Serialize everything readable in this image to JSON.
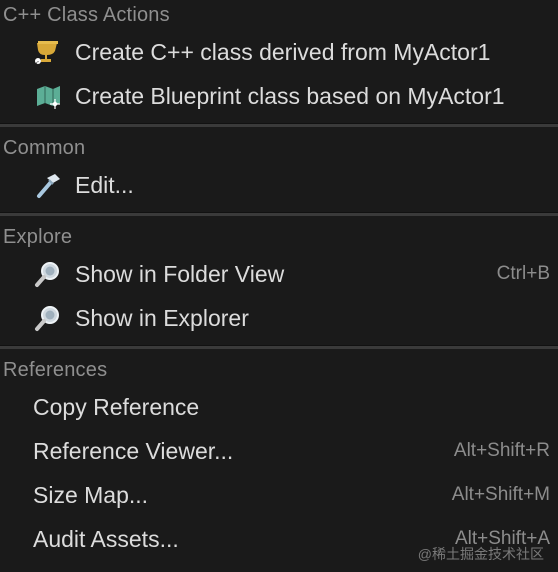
{
  "sections": {
    "cpp": {
      "header": "C++ Class Actions",
      "items": [
        {
          "label": "Create C++ class derived from MyActor1",
          "icon": "cpp-class-icon"
        },
        {
          "label": "Create Blueprint class based on MyActor1",
          "icon": "blueprint-class-icon"
        }
      ]
    },
    "common": {
      "header": "Common",
      "items": [
        {
          "label": "Edit...",
          "icon": "hammer-icon"
        }
      ]
    },
    "explore": {
      "header": "Explore",
      "items": [
        {
          "label": "Show in Folder View",
          "icon": "magnifier-icon",
          "shortcut": "Ctrl+B"
        },
        {
          "label": "Show in Explorer",
          "icon": "magnifier-icon"
        }
      ]
    },
    "references": {
      "header": "References",
      "items": [
        {
          "label": "Copy Reference"
        },
        {
          "label": "Reference Viewer...",
          "shortcut": "Alt+Shift+R"
        },
        {
          "label": "Size Map...",
          "shortcut": "Alt+Shift+M"
        },
        {
          "label": "Audit Assets...",
          "shortcut": "Alt+Shift+A"
        }
      ]
    }
  },
  "watermark": "@稀土掘金技术社区",
  "colors": {
    "background": "#1a1a1a",
    "header_text": "#8f8f8f",
    "item_text": "#dcdcdc",
    "shortcut_text": "#8c8c8c",
    "separator": "#3a3a3a"
  }
}
